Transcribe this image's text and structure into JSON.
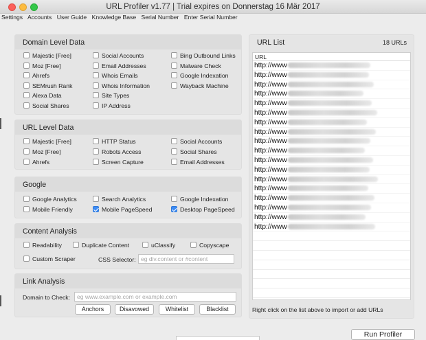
{
  "window": {
    "title": "URL Profiler v1.77 | Trial expires on Donnerstag 16 Mär 2017"
  },
  "menu": [
    "Settings",
    "Accounts",
    "User Guide",
    "Knowledge Base",
    "Serial Number",
    "Enter Serial Number"
  ],
  "domain_level": {
    "title": "Domain Level Data",
    "col1": [
      {
        "label": "Majestic [Free]",
        "checked": false
      },
      {
        "label": "Moz [Free]",
        "checked": false
      },
      {
        "label": "Ahrefs",
        "checked": false
      },
      {
        "label": "SEMrush Rank",
        "checked": false
      },
      {
        "label": "Alexa Data",
        "checked": false
      },
      {
        "label": "Social Shares",
        "checked": false
      }
    ],
    "col2": [
      {
        "label": "Social Accounts",
        "checked": false
      },
      {
        "label": "Email Addresses",
        "checked": false
      },
      {
        "label": "Whois Emails",
        "checked": false
      },
      {
        "label": "Whois Information",
        "checked": false
      },
      {
        "label": "Site Types",
        "checked": false
      },
      {
        "label": "IP Address",
        "checked": false
      }
    ],
    "col3": [
      {
        "label": "Bing Outbound Links",
        "checked": false
      },
      {
        "label": "Malware Check",
        "checked": false
      },
      {
        "label": "Google Indexation",
        "checked": false
      },
      {
        "label": "Wayback Machine",
        "checked": false
      }
    ]
  },
  "url_level": {
    "title": "URL Level Data",
    "col1": [
      {
        "label": "Majestic [Free]",
        "checked": false
      },
      {
        "label": "Moz [Free]",
        "checked": false
      },
      {
        "label": "Ahrefs",
        "checked": false
      }
    ],
    "col2": [
      {
        "label": "HTTP Status",
        "checked": false
      },
      {
        "label": "Robots Access",
        "checked": false
      },
      {
        "label": "Screen Capture",
        "checked": false
      }
    ],
    "col3": [
      {
        "label": "Social Accounts",
        "checked": false
      },
      {
        "label": "Social Shares",
        "checked": false
      },
      {
        "label": "Email Addresses",
        "checked": false
      }
    ]
  },
  "google": {
    "title": "Google",
    "col1": [
      {
        "label": "Google Analytics",
        "checked": false
      },
      {
        "label": "Mobile Friendly",
        "checked": false
      }
    ],
    "col2": [
      {
        "label": "Search Analytics",
        "checked": false
      },
      {
        "label": "Mobile PageSpeed",
        "checked": true
      }
    ],
    "col3": [
      {
        "label": "Google Indexation",
        "checked": false
      },
      {
        "label": "Desktop PageSpeed",
        "checked": true
      }
    ]
  },
  "content_analysis": {
    "title": "Content Analysis",
    "row1": [
      {
        "label": "Readability",
        "checked": false
      },
      {
        "label": "Duplicate Content",
        "checked": false
      },
      {
        "label": "uClassify",
        "checked": false
      },
      {
        "label": "Copyscape",
        "checked": false
      }
    ],
    "custom_scraper": {
      "label": "Custom Scraper",
      "checked": false
    },
    "css_selector_label": "CSS Selector:",
    "css_selector_placeholder": "eg div.content or #content"
  },
  "link_analysis": {
    "title": "Link Analysis",
    "domain_label": "Domain to Check:",
    "domain_placeholder": "eg www.example.com or example.com",
    "buttons": [
      "Anchors",
      "Disavowed",
      "Whitelist",
      "Blacklist"
    ]
  },
  "url_list": {
    "title": "URL List",
    "count": "18 URLs",
    "column_header": "URL",
    "urls": [
      "http://www",
      "http://www",
      "http://www",
      "http://www",
      "http://www",
      "http://www",
      "http://www",
      "http://www",
      "http://www",
      "http://www",
      "http://www",
      "http://www",
      "http://www",
      "http://www",
      "http://www",
      "http://www",
      "http://www",
      "http://www"
    ],
    "hint": "Right click on the list above to import or add URLs"
  },
  "run_button": "Run Profiler"
}
